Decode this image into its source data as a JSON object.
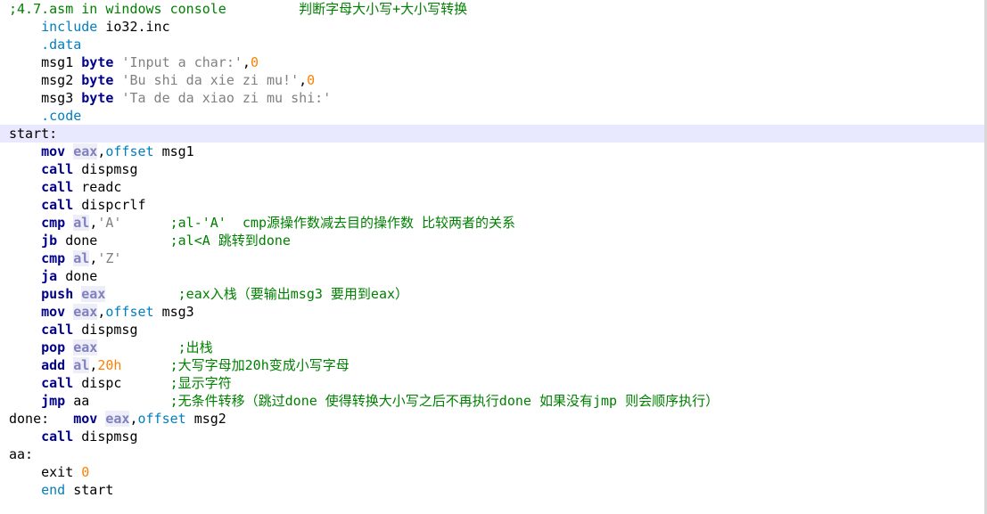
{
  "colors": {
    "background": "#ffffff",
    "current_line": "#e8e8ff",
    "comment": "#008000",
    "directive": "#0080c0",
    "keyword": "#00008b",
    "register": "#8080c0",
    "string": "#808080",
    "number": "#ff8000",
    "text": "#000000"
  },
  "current_line_index": 7,
  "lines": [
    [
      {
        "t": ";4.7.asm in windows console         判断字母大小写+大小写转换",
        "c": "comment"
      }
    ],
    [
      {
        "t": "    "
      },
      {
        "t": "include",
        "c": "directive"
      },
      {
        "t": " io32.inc"
      }
    ],
    [
      {
        "t": "    "
      },
      {
        "t": ".data",
        "c": "directive"
      }
    ],
    [
      {
        "t": "    msg1 "
      },
      {
        "t": "byte",
        "c": "keyword"
      },
      {
        "t": " "
      },
      {
        "t": "'Input a char:'",
        "c": "string"
      },
      {
        "t": ","
      },
      {
        "t": "0",
        "c": "number"
      }
    ],
    [
      {
        "t": "    msg2 "
      },
      {
        "t": "byte",
        "c": "keyword"
      },
      {
        "t": " "
      },
      {
        "t": "'Bu shi da xie zi mu!'",
        "c": "string"
      },
      {
        "t": ","
      },
      {
        "t": "0",
        "c": "number"
      }
    ],
    [
      {
        "t": "    msg3 "
      },
      {
        "t": "byte",
        "c": "keyword"
      },
      {
        "t": " "
      },
      {
        "t": "'Ta de da xiao zi mu shi:'",
        "c": "string"
      }
    ],
    [
      {
        "t": "    "
      },
      {
        "t": ".code",
        "c": "directive"
      }
    ],
    [
      {
        "t": "start:"
      }
    ],
    [
      {
        "t": "    "
      },
      {
        "t": "mov",
        "c": "keyword"
      },
      {
        "t": " "
      },
      {
        "t": "eax",
        "c": "register"
      },
      {
        "t": ","
      },
      {
        "t": "offset",
        "c": "directive"
      },
      {
        "t": " msg1"
      }
    ],
    [
      {
        "t": "    "
      },
      {
        "t": "call",
        "c": "keyword"
      },
      {
        "t": " dispmsg"
      }
    ],
    [
      {
        "t": "    "
      },
      {
        "t": "call",
        "c": "keyword"
      },
      {
        "t": " readc"
      }
    ],
    [
      {
        "t": "    "
      },
      {
        "t": "call",
        "c": "keyword"
      },
      {
        "t": " dispcrlf"
      }
    ],
    [
      {
        "t": "    "
      },
      {
        "t": "cmp",
        "c": "keyword"
      },
      {
        "t": " "
      },
      {
        "t": "al",
        "c": "register"
      },
      {
        "t": ","
      },
      {
        "t": "'A'",
        "c": "string"
      },
      {
        "t": "      "
      },
      {
        "t": ";al-'A'  cmp源操作数减去目的操作数 比较两者的关系",
        "c": "comment"
      }
    ],
    [
      {
        "t": "    "
      },
      {
        "t": "jb",
        "c": "keyword"
      },
      {
        "t": " done         "
      },
      {
        "t": ";al<A 跳转到done",
        "c": "comment"
      }
    ],
    [
      {
        "t": "    "
      },
      {
        "t": "cmp",
        "c": "keyword"
      },
      {
        "t": " "
      },
      {
        "t": "al",
        "c": "register"
      },
      {
        "t": ","
      },
      {
        "t": "'Z'",
        "c": "string"
      }
    ],
    [
      {
        "t": "    "
      },
      {
        "t": "ja",
        "c": "keyword"
      },
      {
        "t": " done"
      }
    ],
    [
      {
        "t": "    "
      },
      {
        "t": "push",
        "c": "keyword"
      },
      {
        "t": " "
      },
      {
        "t": "eax",
        "c": "register"
      },
      {
        "t": "         "
      },
      {
        "t": ";eax入栈（要输出msg3 要用到eax）",
        "c": "comment"
      }
    ],
    [
      {
        "t": "    "
      },
      {
        "t": "mov",
        "c": "keyword"
      },
      {
        "t": " "
      },
      {
        "t": "eax",
        "c": "register"
      },
      {
        "t": ","
      },
      {
        "t": "offset",
        "c": "directive"
      },
      {
        "t": " msg3"
      }
    ],
    [
      {
        "t": "    "
      },
      {
        "t": "call",
        "c": "keyword"
      },
      {
        "t": " dispmsg"
      }
    ],
    [
      {
        "t": "    "
      },
      {
        "t": "pop",
        "c": "keyword"
      },
      {
        "t": " "
      },
      {
        "t": "eax",
        "c": "register"
      },
      {
        "t": "          "
      },
      {
        "t": ";出栈",
        "c": "comment"
      }
    ],
    [
      {
        "t": "    "
      },
      {
        "t": "add",
        "c": "keyword"
      },
      {
        "t": " "
      },
      {
        "t": "al",
        "c": "register"
      },
      {
        "t": ","
      },
      {
        "t": "20h",
        "c": "number"
      },
      {
        "t": "      "
      },
      {
        "t": ";大写字母加20h变成小写字母",
        "c": "comment"
      }
    ],
    [
      {
        "t": "    "
      },
      {
        "t": "call",
        "c": "keyword"
      },
      {
        "t": " dispc      "
      },
      {
        "t": ";显示字符",
        "c": "comment"
      }
    ],
    [
      {
        "t": "    "
      },
      {
        "t": "jmp",
        "c": "keyword"
      },
      {
        "t": " aa          "
      },
      {
        "t": ";无条件转移（跳过done 使得转换大小写之后不再执行done 如果没有jmp 则会顺序执行）",
        "c": "comment"
      }
    ],
    [
      {
        "t": "done:   "
      },
      {
        "t": "mov",
        "c": "keyword"
      },
      {
        "t": " "
      },
      {
        "t": "eax",
        "c": "register"
      },
      {
        "t": ","
      },
      {
        "t": "offset",
        "c": "directive"
      },
      {
        "t": " msg2"
      }
    ],
    [
      {
        "t": "    "
      },
      {
        "t": "call",
        "c": "keyword"
      },
      {
        "t": " dispmsg"
      }
    ],
    [
      {
        "t": "aa:"
      }
    ],
    [
      {
        "t": "    exit "
      },
      {
        "t": "0",
        "c": "number"
      }
    ],
    [
      {
        "t": "    "
      },
      {
        "t": "end",
        "c": "directive"
      },
      {
        "t": " start"
      }
    ]
  ]
}
